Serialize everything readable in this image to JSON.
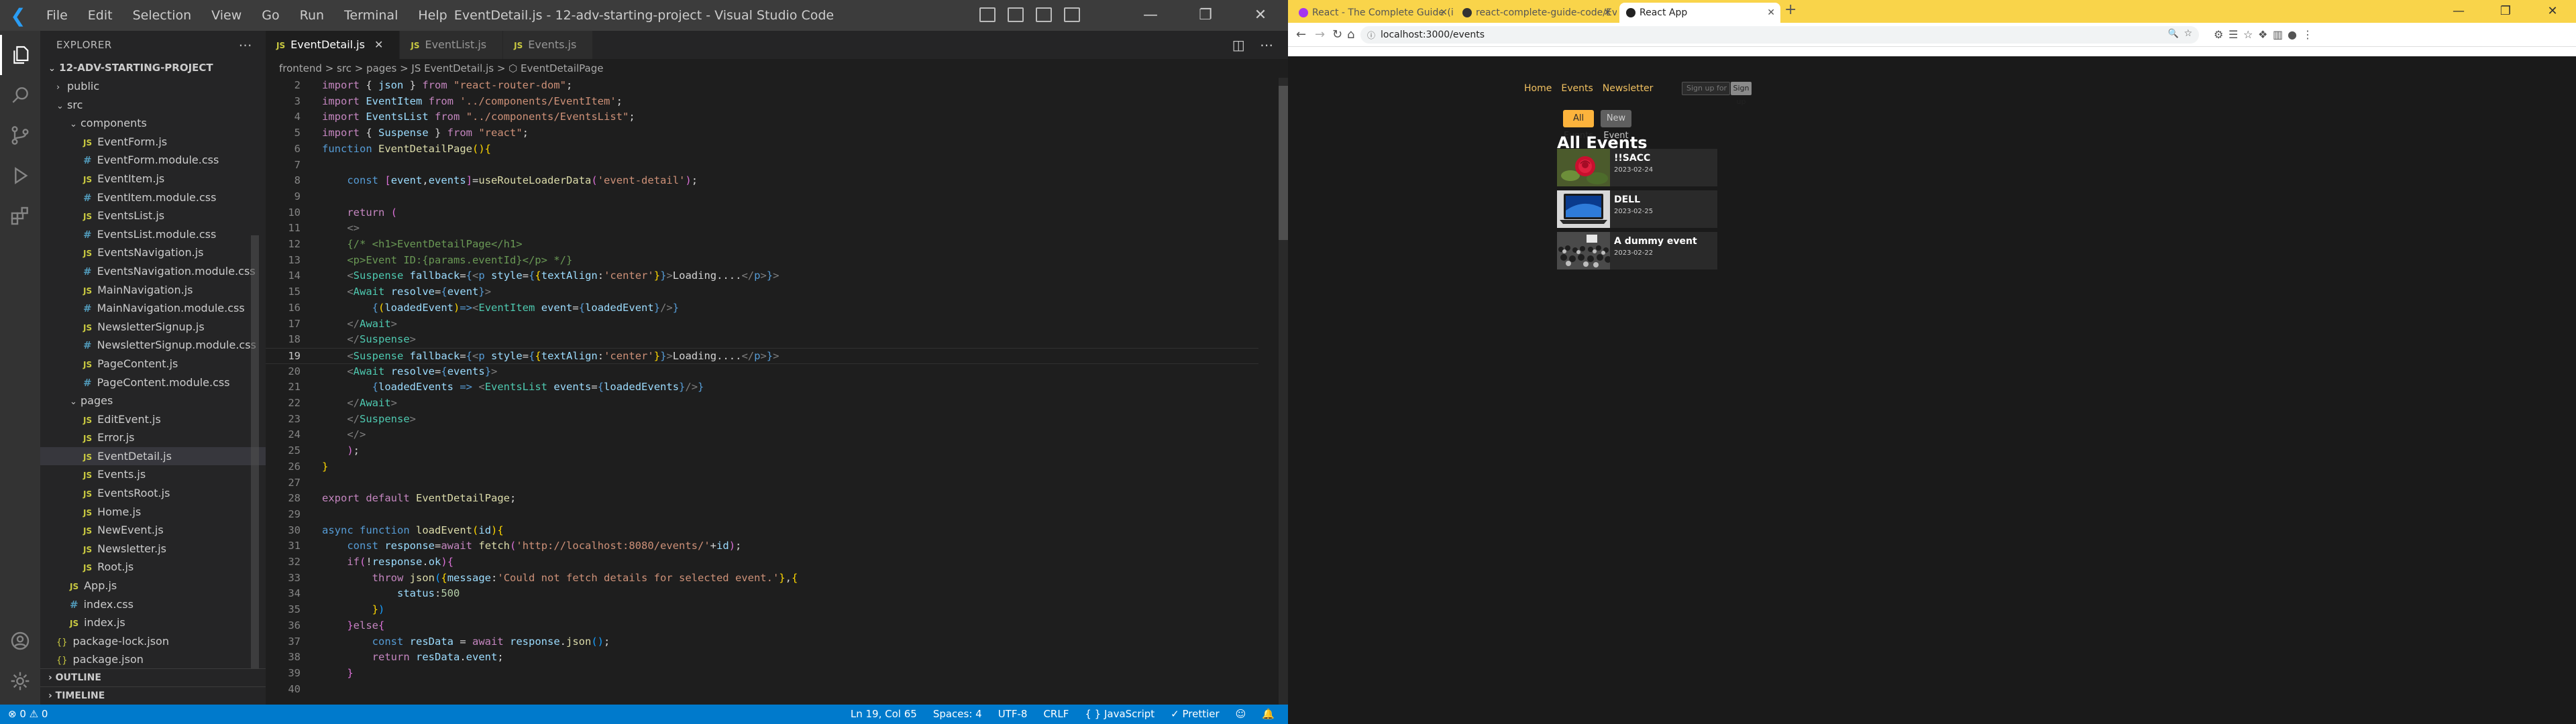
{
  "vscode": {
    "menu": [
      "File",
      "Edit",
      "Selection",
      "View",
      "Go",
      "Run",
      "Terminal",
      "Help"
    ],
    "window_title": "EventDetail.js - 12-adv-starting-project - Visual Studio Code",
    "explorer_label": "EXPLORER",
    "project_name": "12-ADV-STARTING-PROJECT",
    "tree": [
      {
        "label": "public",
        "indent": 1,
        "kind": "folder-closed"
      },
      {
        "label": "src",
        "indent": 1,
        "kind": "folder-open"
      },
      {
        "label": "components",
        "indent": 2,
        "kind": "folder-open"
      },
      {
        "label": "EventForm.js",
        "indent": 3,
        "kind": "js"
      },
      {
        "label": "EventForm.module.css",
        "indent": 3,
        "kind": "css"
      },
      {
        "label": "EventItem.js",
        "indent": 3,
        "kind": "js"
      },
      {
        "label": "EventItem.module.css",
        "indent": 3,
        "kind": "css"
      },
      {
        "label": "EventsList.js",
        "indent": 3,
        "kind": "js"
      },
      {
        "label": "EventsList.module.css",
        "indent": 3,
        "kind": "css"
      },
      {
        "label": "EventsNavigation.js",
        "indent": 3,
        "kind": "js"
      },
      {
        "label": "EventsNavigation.module.css",
        "indent": 3,
        "kind": "css"
      },
      {
        "label": "MainNavigation.js",
        "indent": 3,
        "kind": "js"
      },
      {
        "label": "MainNavigation.module.css",
        "indent": 3,
        "kind": "css"
      },
      {
        "label": "NewsletterSignup.js",
        "indent": 3,
        "kind": "js"
      },
      {
        "label": "NewsletterSignup.module.css",
        "indent": 3,
        "kind": "css"
      },
      {
        "label": "PageContent.js",
        "indent": 3,
        "kind": "js"
      },
      {
        "label": "PageContent.module.css",
        "indent": 3,
        "kind": "css"
      },
      {
        "label": "pages",
        "indent": 2,
        "kind": "folder-open"
      },
      {
        "label": "EditEvent.js",
        "indent": 3,
        "kind": "js"
      },
      {
        "label": "Error.js",
        "indent": 3,
        "kind": "js"
      },
      {
        "label": "EventDetail.js",
        "indent": 3,
        "kind": "js",
        "selected": true
      },
      {
        "label": "Events.js",
        "indent": 3,
        "kind": "js"
      },
      {
        "label": "EventsRoot.js",
        "indent": 3,
        "kind": "js"
      },
      {
        "label": "Home.js",
        "indent": 3,
        "kind": "js"
      },
      {
        "label": "NewEvent.js",
        "indent": 3,
        "kind": "js"
      },
      {
        "label": "Newsletter.js",
        "indent": 3,
        "kind": "js"
      },
      {
        "label": "Root.js",
        "indent": 3,
        "kind": "js"
      },
      {
        "label": "App.js",
        "indent": 2,
        "kind": "js"
      },
      {
        "label": "index.css",
        "indent": 2,
        "kind": "css"
      },
      {
        "label": "index.js",
        "indent": 2,
        "kind": "js"
      },
      {
        "label": "package-lock.json",
        "indent": 1,
        "kind": "json"
      },
      {
        "label": "package.json",
        "indent": 1,
        "kind": "json"
      }
    ],
    "outline_label": "OUTLINE",
    "timeline_label": "TIMELINE",
    "tabs": [
      {
        "label": "EventDetail.js",
        "active": true
      },
      {
        "label": "EventList.js",
        "active": false
      },
      {
        "label": "Events.js",
        "active": false
      }
    ],
    "breadcrumb": "frontend > src > pages > JS EventDetail.js > ⬡ EventDetailPage",
    "current_line": 19,
    "code_lines": [
      {
        "n": 2,
        "html": "<span class='k'>import</span> { <span class='v'>json</span> } <span class='k'>from</span> <span class='s'>\"react-router-dom\"</span>;"
      },
      {
        "n": 3,
        "html": "<span class='k'>import</span> <span class='v'>EventItem</span> <span class='k'>from</span> <span class='s'>'../components/EventItem'</span>;"
      },
      {
        "n": 4,
        "html": "<span class='k'>import</span> <span class='v'>EventsList</span> <span class='k'>from</span> <span class='s'>\"../components/EventsList\"</span>;"
      },
      {
        "n": 5,
        "html": "<span class='k'>import</span> { <span class='v'>Suspense</span> } <span class='k'>from</span> <span class='s'>\"react\"</span>;"
      },
      {
        "n": 6,
        "html": "<span class='b'>function</span> <span class='f'>EventDetailPage</span><span class='y'>()</span><span class='y'>{</span>"
      },
      {
        "n": 7,
        "html": ""
      },
      {
        "n": 8,
        "html": "    <span class='b'>const</span> <span class='p'>[</span><span class='v'>event</span>,<span class='v'>events</span><span class='p'>]</span>=<span class='f'>useRouteLoaderData</span><span class='p'>(</span><span class='s'>'event-detail'</span><span class='p'>)</span>;"
      },
      {
        "n": 9,
        "html": ""
      },
      {
        "n": 10,
        "html": "    <span class='k'>return</span> <span class='p'>(</span>"
      },
      {
        "n": 11,
        "html": "    <span class='g'>&lt;&gt;</span>"
      },
      {
        "n": 12,
        "html": "    <span class='c'>{/* &lt;h1&gt;EventDetailPage&lt;/h1&gt;</span>"
      },
      {
        "n": 13,
        "html": "    <span class='c'>&lt;p&gt;Event ID:{params.eventId}&lt;/p&gt; */}</span>"
      },
      {
        "n": 14,
        "html": "    <span class='g'>&lt;</span><span class='t'>Suspense</span> <span class='v'>fallback</span>=<span class='b'>{</span><span class='g'>&lt;</span><span class='tg'>p</span> <span class='v'>style</span>=<span class='b'>{</span><span class='y'>{</span><span class='v'>textAlign</span>:<span class='s'>'center'</span><span class='y'>}</span><span class='b'>}</span><span class='g'>&gt;</span>Loading....<span class='g'>&lt;/</span><span class='tg'>p</span><span class='g'>&gt;</span><span class='b'>}</span><span class='g'>&gt;</span>"
      },
      {
        "n": 15,
        "html": "    <span class='g'>&lt;</span><span class='t'>Await</span> <span class='v'>resolve</span>=<span class='b'>{</span><span class='v'>event</span><span class='b'>}</span><span class='g'>&gt;</span>"
      },
      {
        "n": 16,
        "html": "        <span class='b'>{</span><span class='y'>(</span><span class='v'>loadedEvent</span><span class='y'>)</span><span class='b'>=&gt;</span><span class='g'>&lt;</span><span class='t'>EventItem</span> <span class='v'>event</span>=<span class='b'>{</span><span class='v'>loadedEvent</span><span class='b'>}</span><span class='g'>/&gt;</span><span class='b'>}</span>"
      },
      {
        "n": 17,
        "html": "    <span class='g'>&lt;/</span><span class='t'>Await</span><span class='g'>&gt;</span>"
      },
      {
        "n": 18,
        "html": "    <span class='g'>&lt;/</span><span class='t'>Suspense</span><span class='g'>&gt;</span>"
      },
      {
        "n": 19,
        "html": "    <span class='g'>&lt;</span><span class='t'>Suspense</span> <span class='v'>fallback</span>=<span class='b'>{</span><span class='g'>&lt;</span><span class='tg'>p</span> <span class='v'>style</span>=<span class='b'>{</span><span class='y'>{</span><span class='v'>textAlign</span>:<span class='s'>'center'</span><span class='y'>}</span><span class='b'>}</span><span class='g'>&gt;</span>Loading....<span class='g'>&lt;/</span><span class='tg'>p</span><span class='g'>&gt;</span><span class='b'>}</span><span class='g'>&gt;</span>"
      },
      {
        "n": 20,
        "html": "    <span class='g'>&lt;</span><span class='t'>Await</span> <span class='v'>resolve</span>=<span class='b'>{</span><span class='v'>events</span><span class='b'>}</span><span class='g'>&gt;</span>"
      },
      {
        "n": 21,
        "html": "        <span class='b'>{</span><span class='v'>loadedEvents</span> <span class='b'>=&gt;</span> <span class='g'>&lt;</span><span class='t'>EventsList</span> <span class='v'>events</span>=<span class='b'>{</span><span class='v'>loadedEvents</span><span class='b'>}</span><span class='g'>/&gt;</span><span class='b'>}</span>"
      },
      {
        "n": 22,
        "html": "    <span class='g'>&lt;/</span><span class='t'>Await</span><span class='g'>&gt;</span>"
      },
      {
        "n": 23,
        "html": "    <span class='g'>&lt;/</span><span class='t'>Suspense</span><span class='g'>&gt;</span>"
      },
      {
        "n": 24,
        "html": "    <span class='g'>&lt;/&gt;</span>"
      },
      {
        "n": 25,
        "html": "    <span class='p'>)</span>;"
      },
      {
        "n": 26,
        "html": "<span class='y'>}</span>"
      },
      {
        "n": 27,
        "html": ""
      },
      {
        "n": 28,
        "html": "<span class='k'>export</span> <span class='k'>default</span> <span class='f'>EventDetailPage</span>;"
      },
      {
        "n": 29,
        "html": ""
      },
      {
        "n": 30,
        "html": "<span class='b'>async</span> <span class='b'>function</span> <span class='f'>loadEvent</span><span class='y'>(</span><span class='v'>id</span><span class='y'>)</span><span class='y'>{</span>"
      },
      {
        "n": 31,
        "html": "    <span class='b'>const</span> <span class='v'>response</span>=<span class='k'>await</span> <span class='f'>fetch</span><span class='p'>(</span><span class='s'>'http://localhost:8080/events/'</span>+<span class='v'>id</span><span class='p'>)</span>;"
      },
      {
        "n": 32,
        "html": "    <span class='k'>if</span><span class='p'>(</span>!<span class='v'>response</span>.<span class='v'>ok</span><span class='p'>)</span><span class='p'>{</span>"
      },
      {
        "n": 33,
        "html": "        <span class='k'>throw</span> <span class='f'>json</span><span class='bl'>(</span><span class='y'>{</span><span class='v'>message</span>:<span class='s'>'Could not fetch details for selected event.'</span><span class='y'>}</span>,<span class='y'>{</span>"
      },
      {
        "n": 34,
        "html": "            <span class='v'>status</span>:<span class='n'>500</span>"
      },
      {
        "n": 35,
        "html": "        <span class='y'>}</span><span class='bl'>)</span>"
      },
      {
        "n": 36,
        "html": "    <span class='p'>}</span><span class='k'>else</span><span class='p'>{</span>"
      },
      {
        "n": 37,
        "html": "        <span class='b'>const</span> <span class='v'>resData</span> = <span class='k'>await</span> <span class='v'>response</span>.<span class='f'>json</span><span class='bl'>()</span>;"
      },
      {
        "n": 38,
        "html": "        <span class='k'>return</span> <span class='v'>resData</span>.<span class='v'>event</span>;"
      },
      {
        "n": 39,
        "html": "    <span class='p'>}</span>"
      },
      {
        "n": 40,
        "html": ""
      }
    ],
    "status": {
      "left": "⊗ 0 ⚠ 0",
      "position": "Ln 19, Col 65",
      "spaces": "Spaces: 4",
      "encoding": "UTF-8",
      "eol": "CRLF",
      "language": "{ } JavaScript",
      "prettier": "✓ Prettier"
    }
  },
  "browser": {
    "tabs": [
      {
        "label": "React - The Complete Guide (incl",
        "fav": "#a435f0",
        "active": false
      },
      {
        "label": "react-complete-guide-code/Eve",
        "fav": "#333333",
        "active": false
      },
      {
        "label": "React App",
        "fav": "#222222",
        "active": true
      }
    ],
    "url": "localhost:3000/events",
    "page": {
      "nav": [
        "Home",
        "Events",
        "Newsletter"
      ],
      "newsletter_placeholder": "Sign up for newsletter...",
      "signup_label": "Sign up",
      "all_events_label": "All Events",
      "new_event_label": "New Event",
      "heading": "All Events",
      "events": [
        {
          "title": "!!SACC",
          "date": "2023-02-24",
          "image": "rose"
        },
        {
          "title": "DELL",
          "date": "2023-02-25",
          "image": "laptop"
        },
        {
          "title": "A dummy event",
          "date": "2023-02-22",
          "image": "crowd"
        }
      ]
    }
  }
}
